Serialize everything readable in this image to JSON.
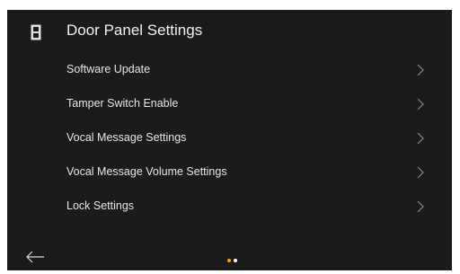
{
  "header": {
    "title": "Door Panel Settings",
    "icon": "door-panel-icon"
  },
  "menu": {
    "items": [
      {
        "label": "Software Update"
      },
      {
        "label": "Tamper Switch Enable"
      },
      {
        "label": "Vocal Message Settings"
      },
      {
        "label": "Vocal Message Volume Settings"
      },
      {
        "label": "Lock Settings"
      }
    ],
    "chevron_icon": "chevron-right-icon"
  },
  "footer": {
    "back_icon": "arrow-left-icon",
    "pager": {
      "total": 2,
      "active": 1
    }
  },
  "colors": {
    "background": "#1b1b1b",
    "text": "#ececec",
    "accent_active_dot": "#f2a900",
    "inactive_dot": "#ffffff"
  }
}
